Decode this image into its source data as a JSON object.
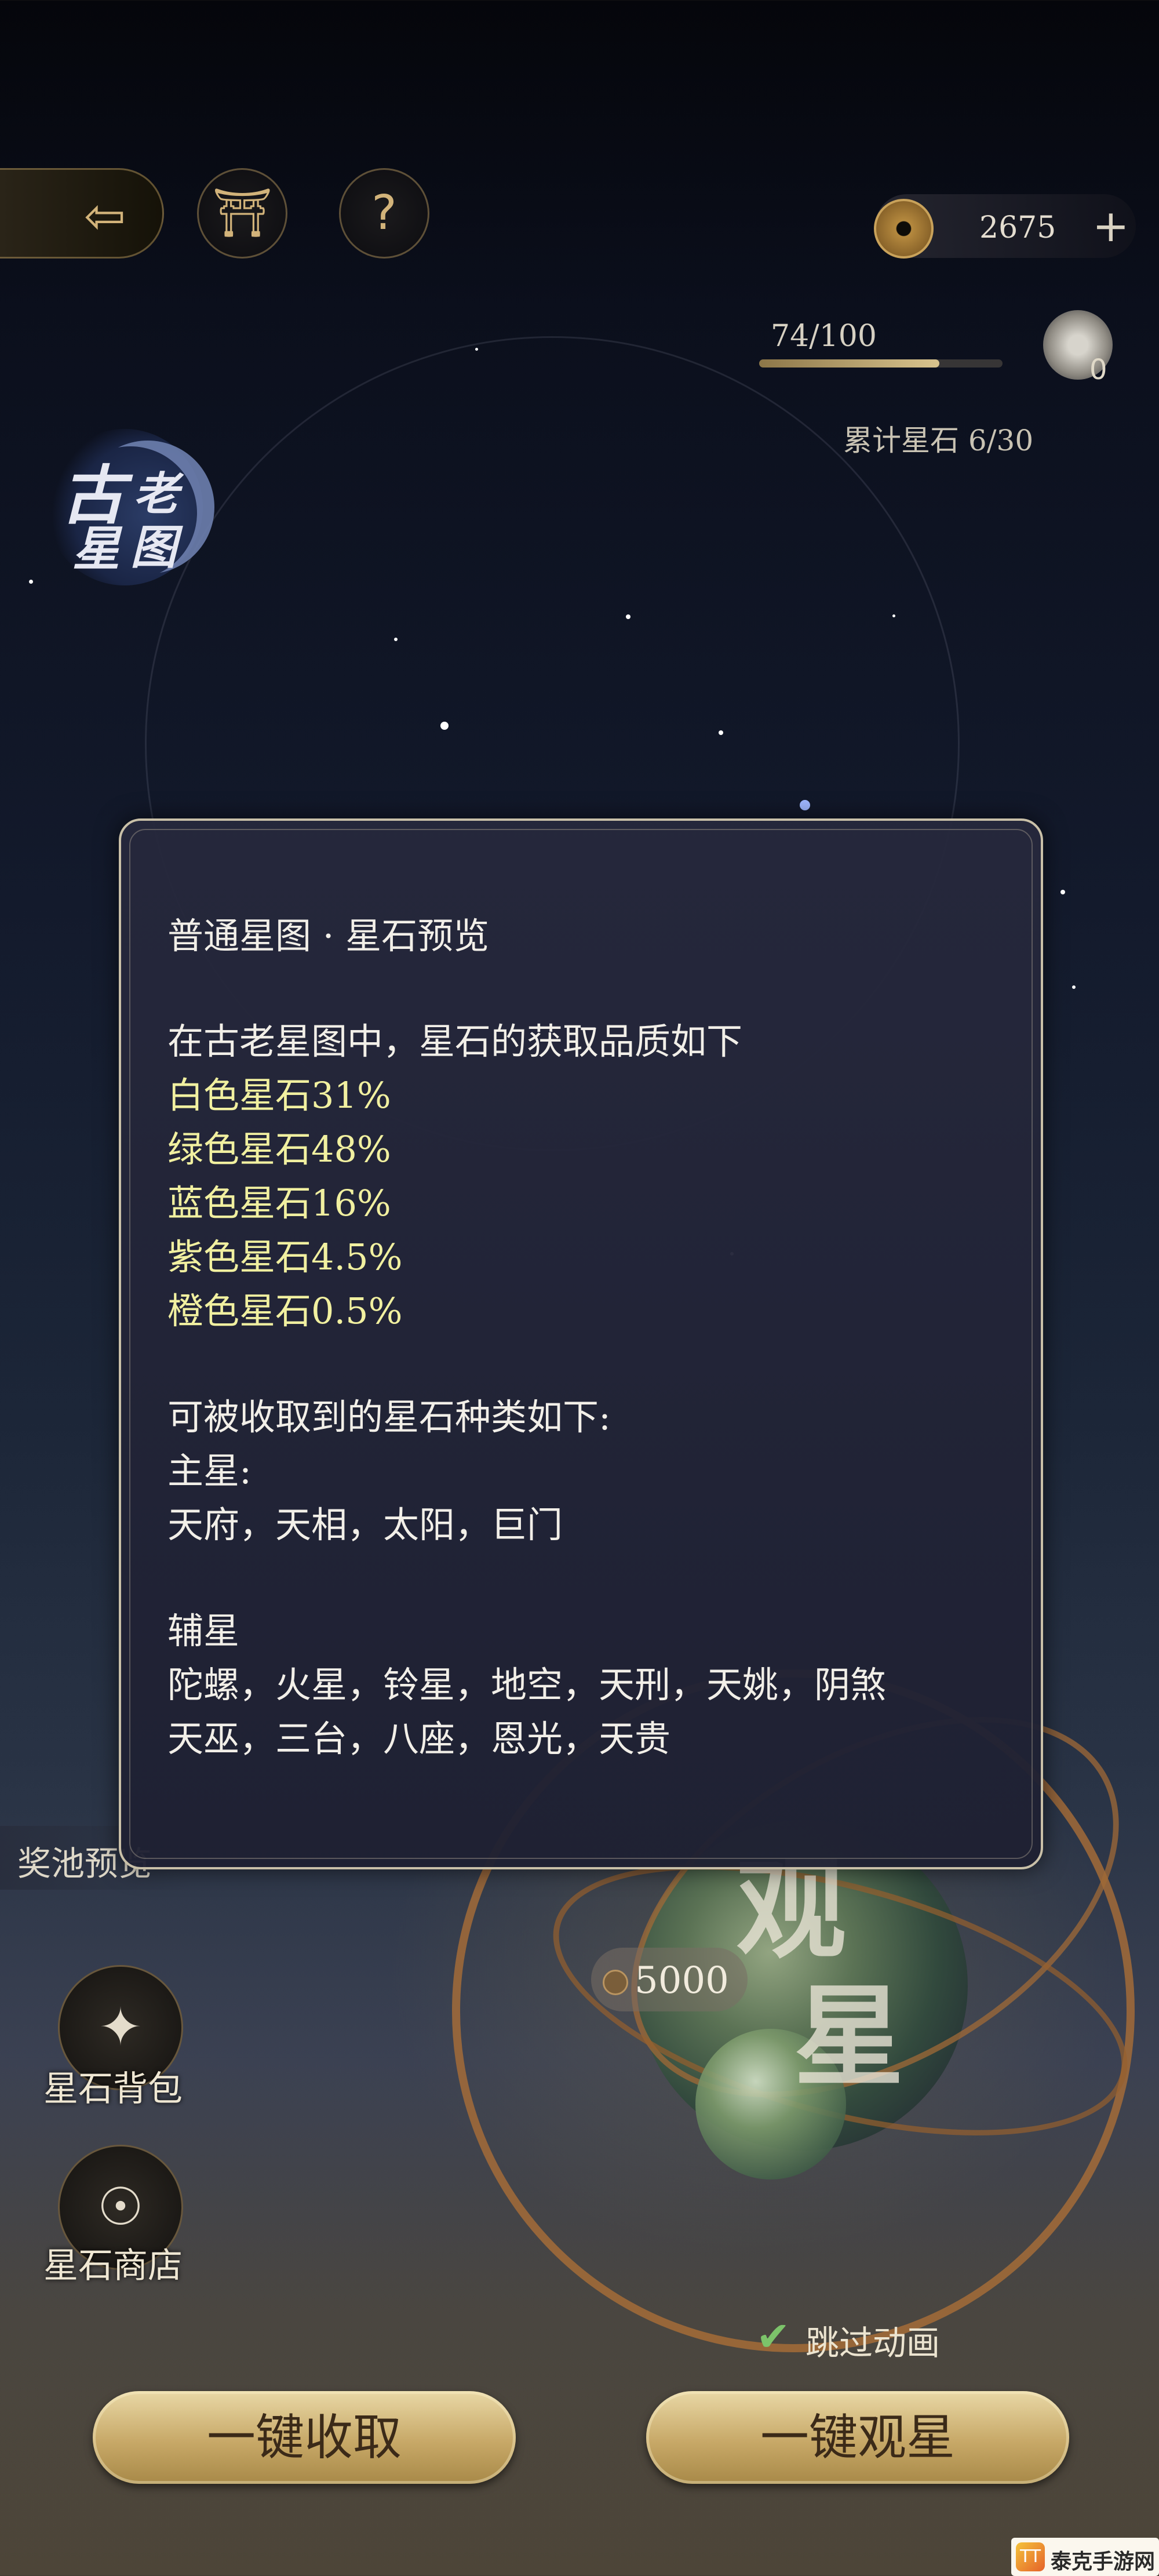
{
  "header": {
    "back_icon": "back-arrow-icon",
    "pavilion_icon": "pavilion-icon",
    "help_symbol": "?",
    "currency": {
      "amount": "2675",
      "plus": "+"
    },
    "progress": {
      "label": "74/100",
      "fraction": 0.74
    },
    "bag_count": "0",
    "accumulated": "累计星石 6/30"
  },
  "logo": {
    "chars": [
      "古",
      "老",
      "星",
      "图"
    ]
  },
  "dialog": {
    "title": "普通星图 · 星石预览",
    "intro": "在古老星图中，星石的获取品质如下",
    "rates": [
      "白色星石31%",
      "绿色星石48%",
      "蓝色星石16%",
      "紫色星石4.5%",
      "橙色星石0.5%"
    ],
    "types_heading": "可被收取到的星石种类如下:",
    "main_label": "主星:",
    "main_stars": "天府，天相，太阳，巨门",
    "aux_label": "辅星",
    "aux_stars_1": "陀螺，火星，铃星，地空，天刑，天姚，阴煞",
    "aux_stars_2": "天巫，三台，八座，恩光，天贵"
  },
  "side": {
    "pool_preview": "奖池预览",
    "bag_label": "星石背包",
    "shop_label": "星石商店"
  },
  "observe": {
    "big_chars": [
      "观",
      "星"
    ],
    "cost": "5000",
    "skip_label": "跳过动画"
  },
  "actions": {
    "collect_all": "一键收取",
    "observe_all": "一键观星"
  },
  "watermark": {
    "badge": "TT",
    "text": "泰克手游网"
  },
  "colors": {
    "rate_text": "#f1f0a0",
    "button_gold": "#c7a867",
    "check_green": "#7cc36a"
  }
}
